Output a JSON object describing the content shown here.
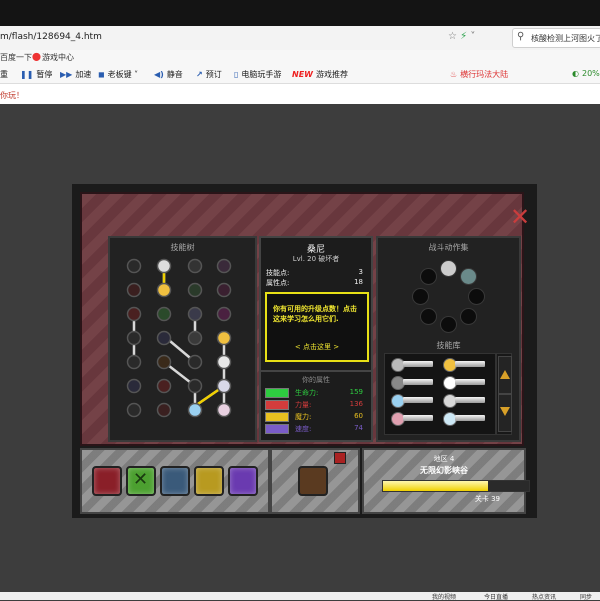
{
  "browser": {
    "url": "m/flash/128694_4.htm",
    "search_text": "核酸检测上河图火了",
    "fav_items": [
      "百度一下",
      "游戏中心"
    ],
    "toolbar_items": [
      "重",
      "暂停",
      "加速",
      "老板键",
      "静音",
      "预订",
      "电脑玩手游",
      "游戏推荐",
      "横行玛法大陆",
      "20%"
    ],
    "new_badge": "NEW",
    "notice": "你玩！",
    "status_items": [
      "我的视频",
      "今日直播",
      "热点资讯",
      "同步"
    ]
  },
  "game": {
    "skill_tree_title": "技能树",
    "character": {
      "name": "桑尼",
      "level_line": "Lvl. 20 破坏者",
      "skill_points_label": "技能点:",
      "skill_points": "3",
      "attr_points_label": "属性点:",
      "attr_points": "18"
    },
    "hint": {
      "text": "你有可用的升级点数！点击这来学习怎么用它们.",
      "link": "< 点击这里 >"
    },
    "stats_title": "你的属性",
    "stats": [
      {
        "label": "生命力:",
        "value": "159",
        "color": "#2ecc40"
      },
      {
        "label": "力量:",
        "value": "136",
        "color": "#d33c3c"
      },
      {
        "label": "魔力:",
        "value": "60",
        "color": "#e8c020"
      },
      {
        "label": "速度:",
        "value": "74",
        "color": "#7a5cc8"
      }
    ],
    "battle_actions_title": "战斗动作集",
    "skill_library_title": "技能库",
    "stage": {
      "area": "地区 4",
      "name": "无限幻影峡谷",
      "progress": 0.72,
      "level": "关卡 39"
    }
  }
}
